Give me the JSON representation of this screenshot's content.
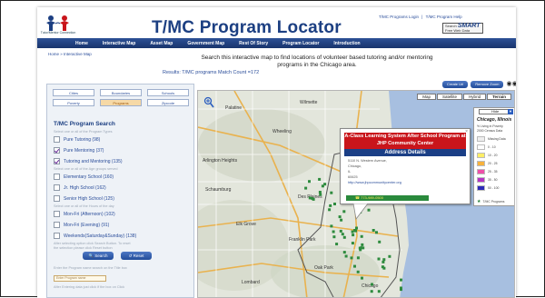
{
  "header": {
    "logo_text": "Tutor/Mentor Connection",
    "title": "T/MC Program Locator",
    "top_links": [
      "T/MC Programs Login",
      "|",
      "T/MC Program Help"
    ],
    "badge_small": "Search",
    "badge_brand": "SMART",
    "badge_sub": "Free Web Data"
  },
  "nav": [
    "Home",
    "Interactive Map",
    "Asset Map",
    "Government Map",
    "Rest Of Story",
    "Program Locator",
    "Introduction"
  ],
  "breadcrumb": "Home » Interactive Map",
  "intro": "Search this interactive map to find locations of volunteer based tutoring and/or mentoring programs in the Chicago area.",
  "results": "Results: T/MC programs Match Count =172",
  "buttons": {
    "create_url": "Create Url",
    "remove_zoom": "Remove Zoom",
    "search": "Search",
    "reset": "Reset"
  },
  "sidebar": {
    "tabs_row1": [
      {
        "label": "Cities",
        "active": false
      },
      {
        "label": "Boundaries",
        "active": false
      },
      {
        "label": "Schools",
        "active": false
      }
    ],
    "tabs_row2": [
      {
        "label": "Poverty",
        "active": false
      },
      {
        "label": "Programs",
        "active": true
      },
      {
        "label": "Zipcode",
        "active": false
      }
    ],
    "search_title": "T/MC Program Search",
    "hint_types": "Select one or all of the Program Types",
    "hint_ages": "Select one or all of the Age groups served",
    "hint_times": "Select one or all of the Hours of the day",
    "hint_after": "After selecting option click Search Button. To reset",
    "hint_after2": "the selection please click Reset button",
    "hint_code": "Enter the Program name search on the Title box",
    "hint_code2": "After Entering data just click if the box on Click",
    "code_placeholder": "Enter Program name",
    "options": [
      {
        "label": "Pure Tutoring  (98)",
        "checked": false
      },
      {
        "label": "Pure Mentoring  (37)",
        "checked": true
      },
      {
        "label": "Tutoring and Mentoring  (135)",
        "checked": true
      },
      {
        "label": "Elementary School  (160)",
        "checked": false
      },
      {
        "label": "Jr. High School  (162)",
        "checked": false
      },
      {
        "label": "Senior High School  (125)",
        "checked": false
      },
      {
        "label": "Mon-Fri (Afternoon)  (102)",
        "checked": false
      },
      {
        "label": "Mon-Fri (Evening)  (91)",
        "checked": false
      },
      {
        "label": "Weekends(Saturday&Sunday)  (138)",
        "checked": false
      }
    ]
  },
  "map": {
    "types": [
      "Map",
      "Satellite",
      "Hybrid",
      "Terrain"
    ],
    "active_type": "Terrain",
    "popup": {
      "title": "A-Class Learning System After School Program at JHP Community Center",
      "subtitle": "Address Details",
      "lines": [
        "5110 N. Western Avenue,",
        "Chicago,",
        "IL",
        "60625",
        "http://www.jhpcommunitycenter.org"
      ],
      "phone": "773-989-0500"
    },
    "legend": {
      "hide": "Hide",
      "title": "Chicago, Illinois",
      "line1": "% Living in Poverty",
      "line2": "2000 Census Data",
      "items": [
        {
          "label": "Missing Data",
          "color": "#eeeeee"
        },
        {
          "label": "0 - 10",
          "color": "#ffffff"
        },
        {
          "label": "10 - 20",
          "color": "#ffee66"
        },
        {
          "label": "20 - 25",
          "color": "#f7b23c"
        },
        {
          "label": "25 - 35",
          "color": "#ee4fa8"
        },
        {
          "label": "35 - 50",
          "color": "#b433c4"
        },
        {
          "label": "50 - 100",
          "color": "#2d2ab8"
        }
      ],
      "marker_label": "T/MC Programs"
    }
  },
  "colors": {
    "brand": "#1c3f82",
    "nav": "#23447f",
    "popup_red": "#c9151b",
    "marker_green": "#2e8b3e"
  }
}
